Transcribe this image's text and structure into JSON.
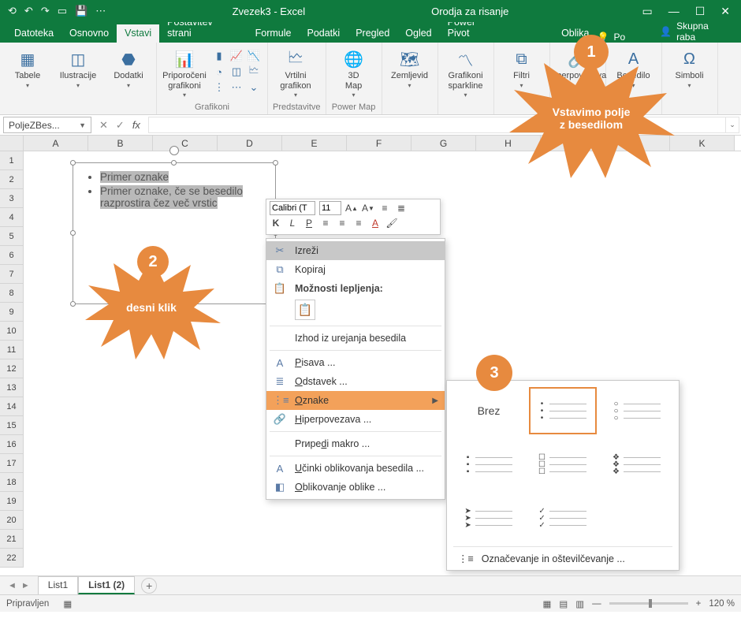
{
  "titlebar": {
    "titleLeft": "Zvezek3 - Excel",
    "titleRight": "Orodja za risanje"
  },
  "tabs": {
    "items": [
      "Datoteka",
      "Osnovno",
      "Vstavi",
      "Postavitev strani",
      "Formule",
      "Podatki",
      "Pregled",
      "Ogled",
      "Power Pivot"
    ],
    "context": "Oblika",
    "tell": "Po",
    "share": "Skupna raba",
    "activeIndex": 2
  },
  "ribbon": {
    "groups": [
      {
        "label": "",
        "buttons": [
          {
            "icon": "▦",
            "label": "Tabele"
          },
          {
            "icon": "◫",
            "label": "Ilustracije"
          },
          {
            "icon": "⬣",
            "label": "Dodatki"
          }
        ]
      },
      {
        "label": "Grafikoni",
        "buttons": [
          {
            "icon": "📊",
            "label": "Priporočeni\ngrafikoni"
          }
        ]
      },
      {
        "label": "Predstavitve",
        "buttons": [
          {
            "icon": "🗠",
            "label": "Vrtilni\ngrafikon"
          }
        ]
      },
      {
        "label": "Power Map",
        "buttons": [
          {
            "icon": "🌐",
            "label": "3D\nMap"
          }
        ]
      },
      {
        "label": "",
        "buttons": [
          {
            "icon": "🗺",
            "label": "Zemljevid"
          }
        ]
      },
      {
        "label": "",
        "buttons": [
          {
            "icon": "〽",
            "label": "Grafikoni\nsparkline"
          }
        ]
      },
      {
        "label": "",
        "buttons": [
          {
            "icon": "⧉",
            "label": "Filtri"
          }
        ]
      },
      {
        "label": "Povezave",
        "buttons": [
          {
            "icon": "🔗",
            "label": "Hiperpovezava"
          }
        ]
      },
      {
        "label": "",
        "buttons": [
          {
            "icon": "A",
            "label": "Besedilo"
          }
        ]
      },
      {
        "label": "",
        "buttons": [
          {
            "icon": "Ω",
            "label": "Simboli"
          }
        ]
      }
    ]
  },
  "namebox": "PoljeZBes...",
  "columns": [
    "A",
    "B",
    "C",
    "D",
    "E",
    "F",
    "G",
    "H",
    "I",
    "J",
    "K"
  ],
  "rowCount": 22,
  "textbox": {
    "bullets": [
      "Primer oznake",
      "Primer oznake, če se besedilo razprostira čez več vrstic"
    ]
  },
  "callouts": {
    "c1": {
      "num": "1",
      "text": "Vstavimo polje\nz besedilom"
    },
    "c2": {
      "num": "2",
      "text": "desni klik"
    },
    "c3": {
      "num": "3"
    }
  },
  "minitoolbar": {
    "font": "Calibri (T",
    "size": "11"
  },
  "context": {
    "cut": "Izreži",
    "copy": "Kopiraj",
    "pasteopts": "Možnosti lepljenja:",
    "exitedit": "Izhod iz urejanja besedila",
    "font": "Pisava ...",
    "paragraph": "Odstavek ...",
    "bullets": "Oznake",
    "hyperlink": "Hiperpovezava ...",
    "macro": "Priredi makro ...",
    "texteffects": "Učinki oblikovanja besedila ...",
    "shapeformat": "Oblikovanje oblike ..."
  },
  "bulletsub": {
    "none": "Brez",
    "markers": [
      "•",
      "○",
      "▪",
      "☐",
      "❖",
      "➤",
      "✓"
    ],
    "footer": "Označevanje in oštevilčevanje ..."
  },
  "sheets": {
    "items": [
      "List1",
      "List1 (2)"
    ],
    "activeIndex": 1
  },
  "status": {
    "ready": "Pripravljen",
    "zoom": "120 %"
  }
}
